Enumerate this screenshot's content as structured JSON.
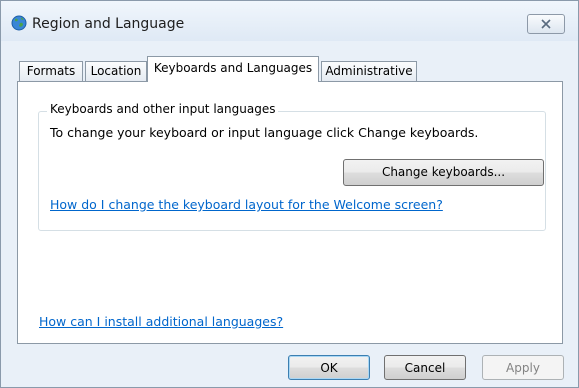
{
  "window": {
    "title": "Region and Language",
    "close_label": "Close"
  },
  "tabs": [
    {
      "label": "Formats",
      "active": false
    },
    {
      "label": "Location",
      "active": false
    },
    {
      "label": "Keyboards and Languages",
      "active": true
    },
    {
      "label": "Administrative",
      "active": false
    }
  ],
  "keyboards_group": {
    "label": "Keyboards and other input languages",
    "description": "To change your keyboard or input language click Change keyboards.",
    "change_button": "Change keyboards...",
    "welcome_link": "How do I change the keyboard layout for the Welcome screen?"
  },
  "install_link": "How can I install additional languages?",
  "footer": {
    "ok": "OK",
    "cancel": "Cancel",
    "apply": "Apply"
  },
  "colors": {
    "link": "#0066cc",
    "panel_border": "#8c99a6",
    "window_bg": "#e9f0f8"
  },
  "icons": {
    "title": "globe-icon",
    "close": "close-icon"
  }
}
